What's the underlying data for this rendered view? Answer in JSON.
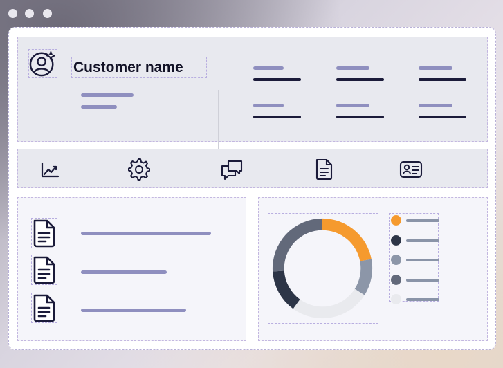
{
  "window": {
    "controls": [
      "close",
      "minimize",
      "maximize"
    ]
  },
  "header": {
    "avatar_icon": "user-sparkle-icon",
    "customer_name": "Customer name"
  },
  "toolbar": {
    "items": [
      {
        "icon": "chart-trend-icon"
      },
      {
        "icon": "gear-icon"
      },
      {
        "icon": "chat-bubbles-icon"
      },
      {
        "icon": "document-icon"
      },
      {
        "icon": "id-card-icon"
      }
    ]
  },
  "documents": {
    "items": [
      {
        "icon": "document-icon"
      },
      {
        "icon": "document-icon"
      },
      {
        "icon": "document-icon"
      }
    ]
  },
  "chart_data": {
    "type": "pie",
    "title": "",
    "values": [
      22,
      12,
      26,
      14,
      26
    ],
    "colors": [
      "#f59a2e",
      "#8c96a8",
      "#e9eaee",
      "#2d3547",
      "#62697a"
    ],
    "legend_colors": [
      "#f59a2e",
      "#2d3547",
      "#8c96a8",
      "#62697a",
      "#e9eaee"
    ]
  },
  "colors": {
    "accent": "#f59a2e",
    "text_dark": "#121226",
    "placeholder_light": "#8f8fbf",
    "placeholder_dark": "#1b1b3a",
    "panel_bg": "#e8e9ef"
  }
}
